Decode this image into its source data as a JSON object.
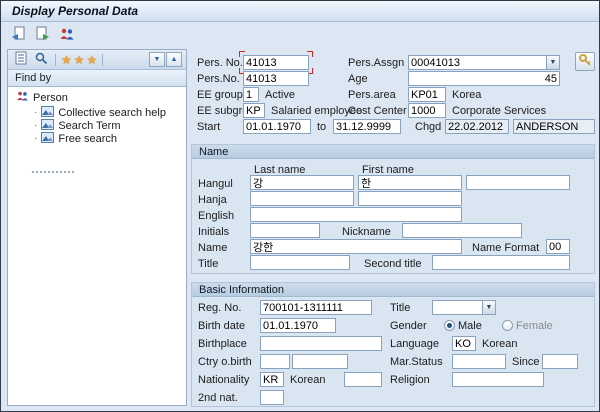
{
  "window": {
    "title": "Display Personal Data"
  },
  "sidebar": {
    "find_by": "Find by",
    "person_label": "Person",
    "items": [
      {
        "label": "Collective search help"
      },
      {
        "label": "Search Term"
      },
      {
        "label": "Free search"
      }
    ]
  },
  "header": {
    "pers_no_label": "Pers. No.",
    "pers_no_value": "41013",
    "pers_assgn_label": "Pers.Assgn",
    "pers_assgn_value": "00041013",
    "pers_no2_label": "Pers.No.",
    "pers_no2_value": "41013",
    "age_label": "Age",
    "age_value": "45",
    "ee_group_label": "EE group",
    "ee_group_value": "1",
    "ee_group_text": "Active",
    "pers_area_label": "Pers.area",
    "pers_area_value": "KP01",
    "pers_area_text": "Korea",
    "ee_subgroup_label": "EE subgroup",
    "ee_subgroup_value": "KP",
    "ee_subgroup_text": "Salaried employee",
    "cost_center_label": "Cost Center",
    "cost_center_value": "1000",
    "cost_center_text": "Corporate Services",
    "start_label": "Start",
    "start_value": "01.01.1970",
    "to_label": "to",
    "end_value": "31.12.9999",
    "chgd_label": "Chgd",
    "chgd_date": "22.02.2012",
    "chgd_by": "ANDERSON"
  },
  "name_section": {
    "title": "Name",
    "col_last_name": "Last name",
    "col_first_name": "First name",
    "hangul_label": "Hangul",
    "hangul_last": "강",
    "hangul_first": "한",
    "hanja_label": "Hanja",
    "english_label": "English",
    "initials_label": "Initials",
    "nickname_label": "Nickname",
    "name_label": "Name",
    "name_value": "강한",
    "name_format_label": "Name Format",
    "name_format_value": "00",
    "title_label": "Title",
    "second_title_label": "Second title"
  },
  "basic_section": {
    "title": "Basic Information",
    "reg_no_label": "Reg. No.",
    "reg_no_value": "700101-1311111",
    "title_label": "Title",
    "birth_date_label": "Birth date",
    "birth_date_value": "01.01.1970",
    "gender_label": "Gender",
    "gender_male": "Male",
    "gender_female": "Female",
    "birthplace_label": "Birthplace",
    "language_label": "Language",
    "language_value": "KO",
    "language_text": "Korean",
    "ctry_birth_label": "Ctry o.birth",
    "mar_status_label": "Mar.Status",
    "since_label": "Since",
    "nationality_label": "Nationality",
    "nationality_value": "KR",
    "nationality_text": "Korean",
    "religion_label": "Religion",
    "second_nat_label": "2nd nat."
  }
}
